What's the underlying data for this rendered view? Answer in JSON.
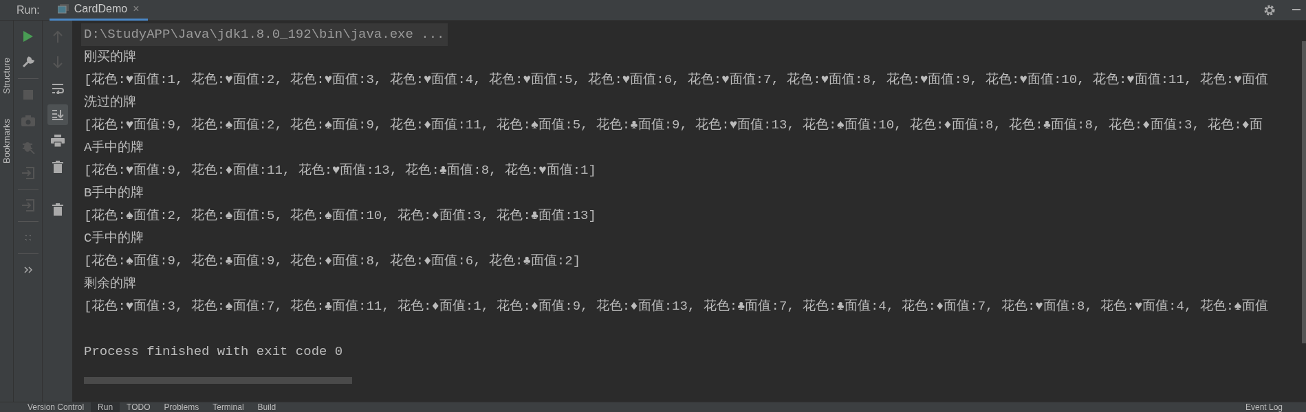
{
  "header": {
    "label": "Run:",
    "tab": {
      "title": "CardDemo",
      "selected": true,
      "close": "×"
    }
  },
  "side_tabs": [
    "Structure",
    "Bookmarks"
  ],
  "console": {
    "lines": [
      {
        "kind": "command",
        "text": "D:\\StudyAPP\\Java\\jdk1.8.0_192\\bin\\java.exe ..."
      },
      {
        "kind": "output",
        "text": "刚买的牌"
      },
      {
        "kind": "output",
        "text": "[花色:♥面值:1, 花色:♥面值:2, 花色:♥面值:3, 花色:♥面值:4, 花色:♥面值:5, 花色:♥面值:6, 花色:♥面值:7, 花色:♥面值:8, 花色:♥面值:9, 花色:♥面值:10, 花色:♥面值:11, 花色:♥面值"
      },
      {
        "kind": "output",
        "text": "洗过的牌"
      },
      {
        "kind": "output",
        "text": "[花色:♥面值:9, 花色:♠面值:2, 花色:♠面值:9, 花色:♦面值:11, 花色:♠面值:5, 花色:♣面值:9, 花色:♥面值:13, 花色:♠面值:10, 花色:♦面值:8, 花色:♣面值:8, 花色:♦面值:3, 花色:♦面"
      },
      {
        "kind": "output",
        "text": "A手中的牌"
      },
      {
        "kind": "output",
        "text": "[花色:♥面值:9, 花色:♦面值:11, 花色:♥面值:13, 花色:♣面值:8, 花色:♥面值:1]"
      },
      {
        "kind": "output",
        "text": "B手中的牌"
      },
      {
        "kind": "output",
        "text": "[花色:♠面值:2, 花色:♠面值:5, 花色:♠面值:10, 花色:♦面值:3, 花色:♣面值:13]"
      },
      {
        "kind": "output",
        "text": "C手中的牌"
      },
      {
        "kind": "output",
        "text": "[花色:♠面值:9, 花色:♣面值:9, 花色:♦面值:8, 花色:♦面值:6, 花色:♣面值:2]"
      },
      {
        "kind": "output",
        "text": "剩余的牌"
      },
      {
        "kind": "output",
        "text": "[花色:♥面值:3, 花色:♠面值:7, 花色:♣面值:11, 花色:♦面值:1, 花色:♦面值:9, 花色:♦面值:13, 花色:♣面值:7, 花色:♣面值:4, 花色:♦面值:7, 花色:♥面值:8, 花色:♥面值:4, 花色:♠面值"
      },
      {
        "kind": "exit",
        "text": "Process finished with exit code 0"
      }
    ]
  },
  "bottom_tabs": [
    {
      "label": "Version Control",
      "selected": false
    },
    {
      "label": "Run",
      "selected": true
    },
    {
      "label": "TODO",
      "selected": false
    },
    {
      "label": "Problems",
      "selected": false
    },
    {
      "label": "Terminal",
      "selected": false
    },
    {
      "label": "Build",
      "selected": false
    }
  ],
  "event_log": "Event Log"
}
